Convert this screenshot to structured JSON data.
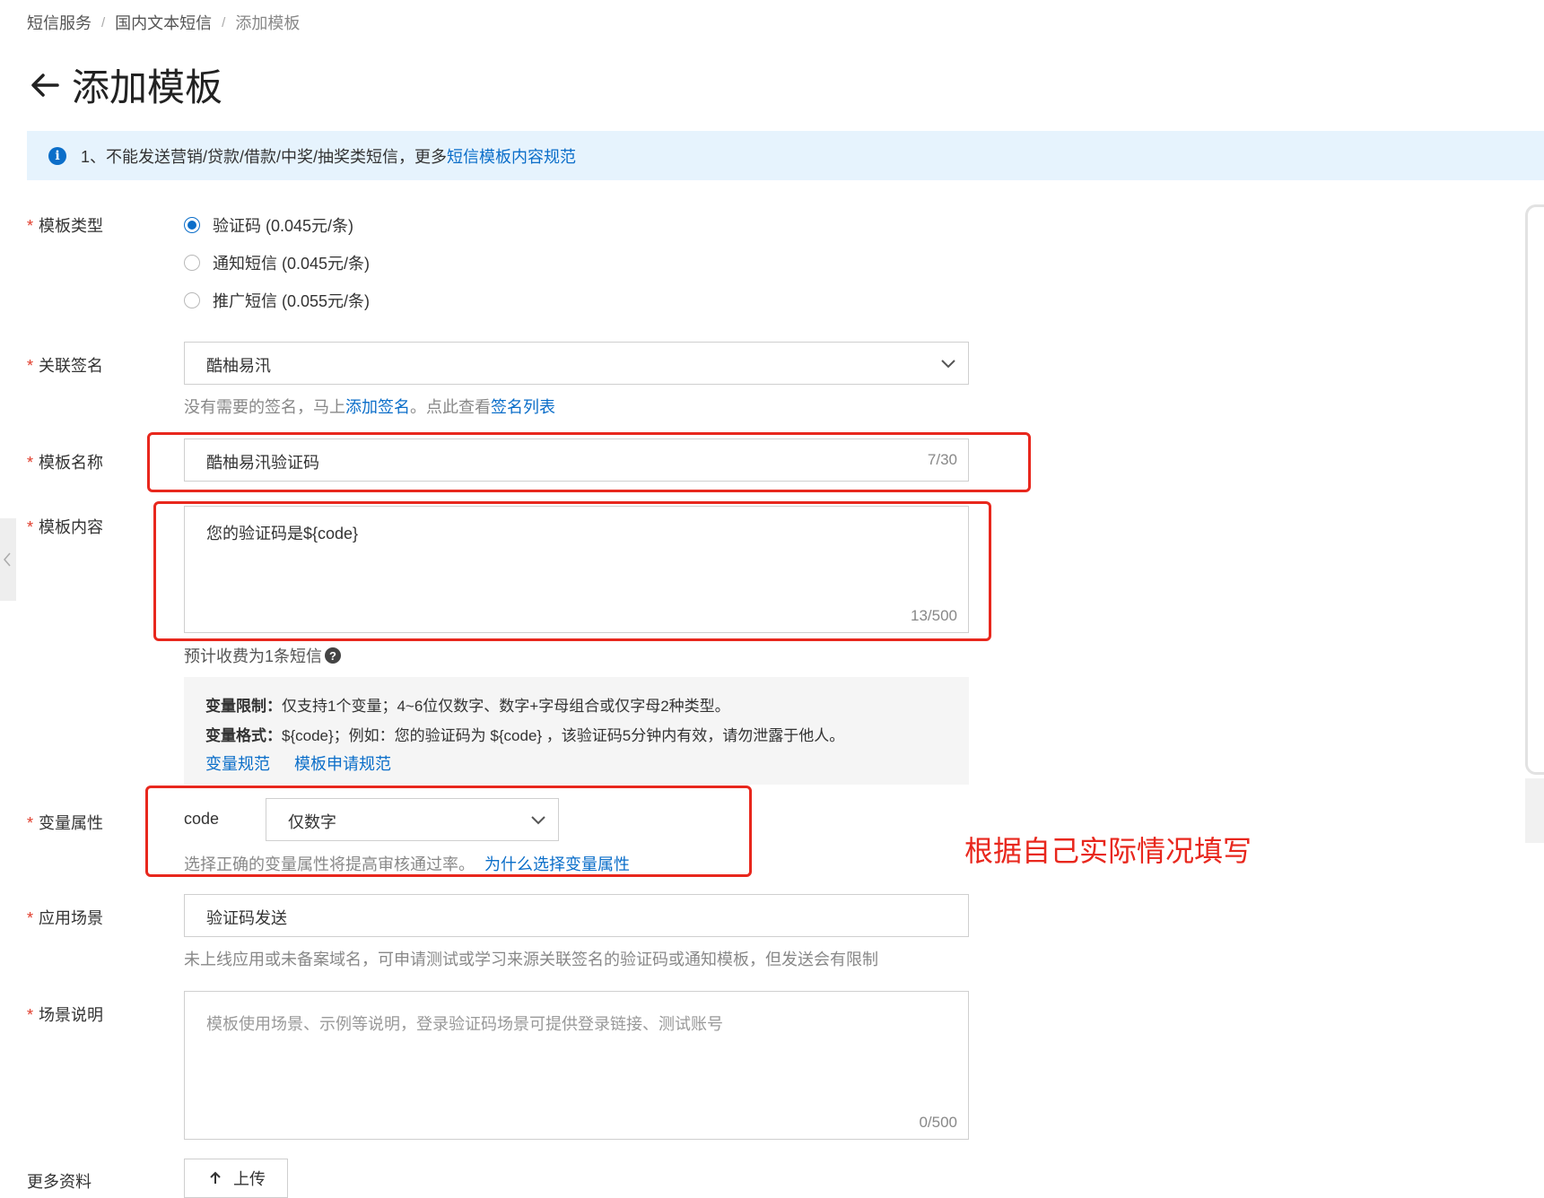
{
  "breadcrumb": {
    "items": [
      "短信服务",
      "国内文本短信",
      "添加模板"
    ],
    "separator": "/"
  },
  "page": {
    "title": "添加模板",
    "back_icon": "arrow-left-icon"
  },
  "notice": {
    "icon": "info-icon",
    "text": "1、不能发送营销/贷款/借款/中奖/抽奖类短信，更多",
    "link": "短信模板内容规范"
  },
  "form": {
    "required_mark": "*",
    "template_type": {
      "label": "模板类型",
      "options": [
        {
          "label": "验证码 (0.045元/条)",
          "checked": true
        },
        {
          "label": "通知短信 (0.045元/条)",
          "checked": false
        },
        {
          "label": "推广短信 (0.055元/条)",
          "checked": false
        }
      ]
    },
    "signature": {
      "label": "关联签名",
      "value": "酷柚易汛",
      "help_prefix": "没有需要的签名，马上",
      "help_link1": "添加签名",
      "help_middle": "。点此查看",
      "help_link2": "签名列表"
    },
    "template_name": {
      "label": "模板名称",
      "value": "酷柚易汛验证码",
      "counter": "7/30"
    },
    "template_content": {
      "label": "模板内容",
      "value": "您的验证码是${code}",
      "counter": "13/500",
      "estimate": "预计收费为1条短信"
    },
    "variable_info": {
      "limit_label": "变量限制：",
      "limit_text": "仅支持1个变量；4~6位仅数字、数字+字母组合或仅字母2种类型。",
      "format_label": "变量格式：",
      "format_text": "${code}；例如：您的验证码为 ${code} ，该验证码5分钟内有效，请勿泄露于他人。",
      "link1": "变量规范",
      "link2": "模板申请规范"
    },
    "variable_attr": {
      "label": "变量属性",
      "var_name": "code",
      "value": "仅数字",
      "help_text": "选择正确的变量属性将提高审核通过率。",
      "help_link": "为什么选择变量属性"
    },
    "scenario": {
      "label": "应用场景",
      "value": "验证码发送",
      "help": "未上线应用或未备案域名，可申请测试或学习来源关联签名的验证码或通知模板，但发送会有限制"
    },
    "scenario_desc": {
      "label": "场景说明",
      "placeholder": "模板使用场景、示例等说明，登录验证码场景可提供登录链接、测试账号",
      "counter": "0/500"
    },
    "more_info": {
      "label": "更多资料",
      "upload_label": "上传"
    }
  },
  "annotation": {
    "text": "根据自己实际情况填写"
  },
  "colors": {
    "accent": "#0b6ec9",
    "required": "#e03b2a",
    "annotation_red": "#e8271d",
    "notice_bg": "#e6f3fd"
  }
}
